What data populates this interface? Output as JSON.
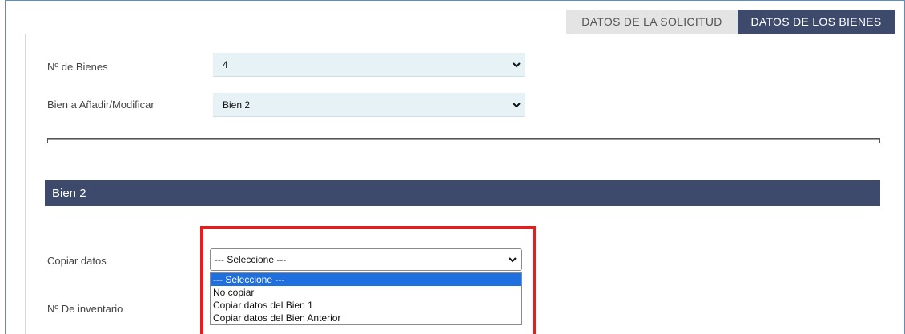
{
  "tabs": [
    {
      "label": "DATOS DE LA SOLICITUD",
      "active": false
    },
    {
      "label": "DATOS DE LOS BIENES",
      "active": true
    }
  ],
  "form": {
    "num_bienes": {
      "label": "Nº de Bienes",
      "value": "4"
    },
    "bien_anadir": {
      "label": "Bien a Añadir/Modificar",
      "value": "Bien 2"
    }
  },
  "section": {
    "title": "Bien 2"
  },
  "copiar": {
    "label": "Copiar datos",
    "value": "--- Seleccione ---",
    "options": [
      "--- Seleccione ---",
      "No copiar",
      "Copiar datos del Bien 1",
      "Copiar datos del Bien Anterior"
    ],
    "highlighted_option": 0
  },
  "inventario": {
    "label": "Nº De inventario"
  },
  "colors": {
    "accent": "#3d4a6b",
    "highlight_border": "#e02020",
    "field_bg": "#e6f2f5",
    "option_selected": "#1e6fe0"
  }
}
